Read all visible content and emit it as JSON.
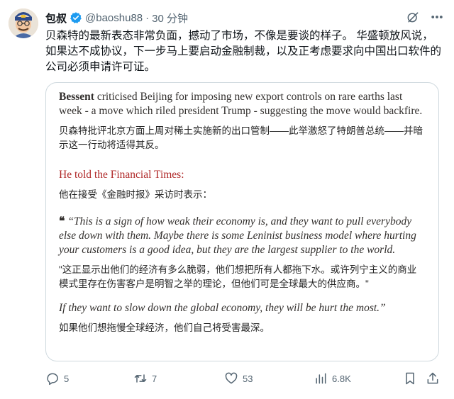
{
  "post": {
    "display_name": "包叔",
    "handle": "@baoshu88",
    "separator": "·",
    "time": "30 分钟",
    "text": "贝森特的最新表态非常负面，撼动了市场，不像是要谈的样子。 华盛顿放风说，如果达不成协议，下一步马上要启动金融制裁，以及正考虑要求向中国出口软件的公司必须申请许可证。"
  },
  "quote": {
    "p1_name": "Bessent",
    "p1_rest": " criticised Beijing for imposing new export controls on rare earths last week - a move which riled president Trump - suggesting the move would backfire.",
    "p1_zh": "贝森特批评北京方面上周对稀土实施新的出口管制——此举激怒了特朗普总统——并暗示这一行动将适得其反。",
    "p2_en": "He told the Financial Times:",
    "p2_zh": "他在接受《金融时报》采访时表示：",
    "q_mark": "❝",
    "q1_en": "“This is a sign of how weak their economy is, and they want to pull everybody else down with them. Maybe there is some Leninist business model where hurting your customers is a good idea, but they are the largest supplier to the world.",
    "q1_zh": "\"这正显示出他们的经济有多么脆弱，他们想把所有人都拖下水。或许列宁主义的商业模式里存在伤害客户是明智之举的理论，但他们可是全球最大的供应商。\"",
    "q2_en": "If they want to slow down the global economy, they will be hurt the most.”",
    "q2_zh": "如果他们想拖慢全球经济，他们自己将受害最深。"
  },
  "actions": {
    "replies": "5",
    "reposts": "7",
    "likes": "53",
    "views": "6.8K"
  },
  "colors": {
    "verified": "#1d9bf0",
    "secondary_text": "#536471",
    "link_red": "#b02a2a",
    "border": "#cfd9de"
  },
  "icons": [
    "grok-icon",
    "more-icon",
    "reply-icon",
    "repost-icon",
    "like-icon",
    "views-icon",
    "bookmark-icon",
    "share-icon"
  ]
}
